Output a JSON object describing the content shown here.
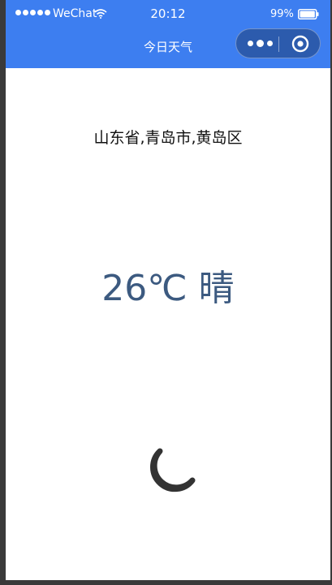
{
  "status_bar": {
    "carrier": "WeChat",
    "time": "20:12",
    "battery_percent": "99%",
    "battery_level": 0.99,
    "signal_bars": 5,
    "wifi_icon": "wifi-icon"
  },
  "nav": {
    "title": "今日天气",
    "more_icon": "more-icon",
    "close_icon": "close-mini-program-icon"
  },
  "weather": {
    "location": "山东省,青岛市,黄岛区",
    "summary": "26℃ 晴",
    "icon": "crescent-moon-icon"
  },
  "colors": {
    "nav_background": "#3d7ef0",
    "temperature_text": "#3c5a80",
    "moon_icon": "#333333"
  }
}
